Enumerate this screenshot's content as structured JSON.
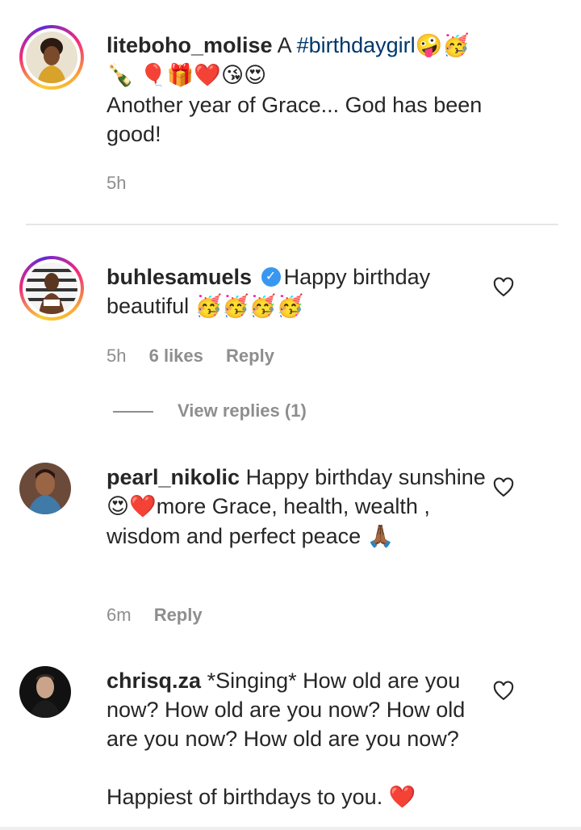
{
  "comments": [
    {
      "username": "liteboho_molise",
      "text": "A ",
      "hashtag": "#birthdaygirl",
      "emojis_line1": "🤪🥳🍾",
      "emojis_line2": "🎈🎁❤️😘😍",
      "text2": "Another year of Grace... God has been good!",
      "time": "5h"
    },
    {
      "username": "buhlesamuels",
      "verified": true,
      "text": "Happy birthday beautiful ",
      "emojis": "🥳🥳🥳🥳",
      "time": "5h",
      "likes": "6 likes",
      "reply": "Reply",
      "view_replies": "View replies (1)"
    },
    {
      "username": "pearl_nikolic",
      "text": "Happy birthday sunshine ",
      "emojis": "😍❤️",
      "text2": "more Grace, health, wealth , wisdom and perfect peace ",
      "emojis2": "🙏🏾",
      "time": "6m",
      "reply": "Reply"
    },
    {
      "username": "chrisq.za",
      "text": "*Singing* How old are you now? How old are you now? How old are you now? How old are you now?",
      "text2": "Happiest of birthdays to you. ",
      "emojis2": "❤️"
    }
  ],
  "colors": {
    "text": "#262626",
    "muted": "#8e8e8e",
    "hashtag": "#00376b",
    "verified": "#3897f0"
  },
  "icons": {
    "like": "heart-outline-icon",
    "verified": "verified-badge-icon"
  }
}
